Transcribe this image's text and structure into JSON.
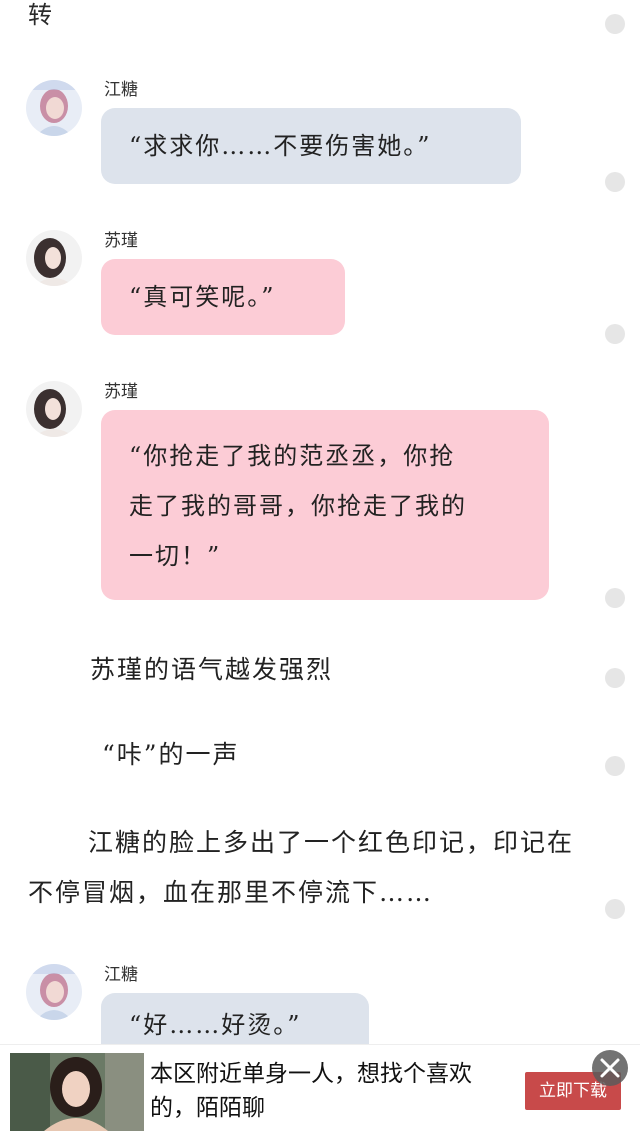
{
  "top_text": "转",
  "messages": [
    {
      "speaker": "江糖",
      "lines": [
        "“求求你……不要伤害她。”"
      ]
    },
    {
      "speaker": "苏瑾",
      "lines": [
        "“真可笑呢。”"
      ]
    },
    {
      "speaker": "苏瑾",
      "lines": [
        "“你抢走了我的范丞丞，你抢",
        "走了我的哥哥，你抢走了我的",
        "一切！”"
      ]
    },
    {
      "speaker": "江糖",
      "lines": [
        "“好……好烫。”"
      ]
    }
  ],
  "narration": [
    "苏瑾的语气越发强烈",
    "“咔”的一声",
    "江糖的脸上多出了一个红色印记，印记在不停冒烟，血在那里不停流下……"
  ],
  "ad": {
    "text": "本区附近单身一人，想找个喜欢的，陌陌聊",
    "button_label": "立即下载"
  },
  "colors": {
    "bubble_blue": "#dde3ec",
    "bubble_pink": "#fcccd6",
    "ad_button": "#c84a4a"
  }
}
